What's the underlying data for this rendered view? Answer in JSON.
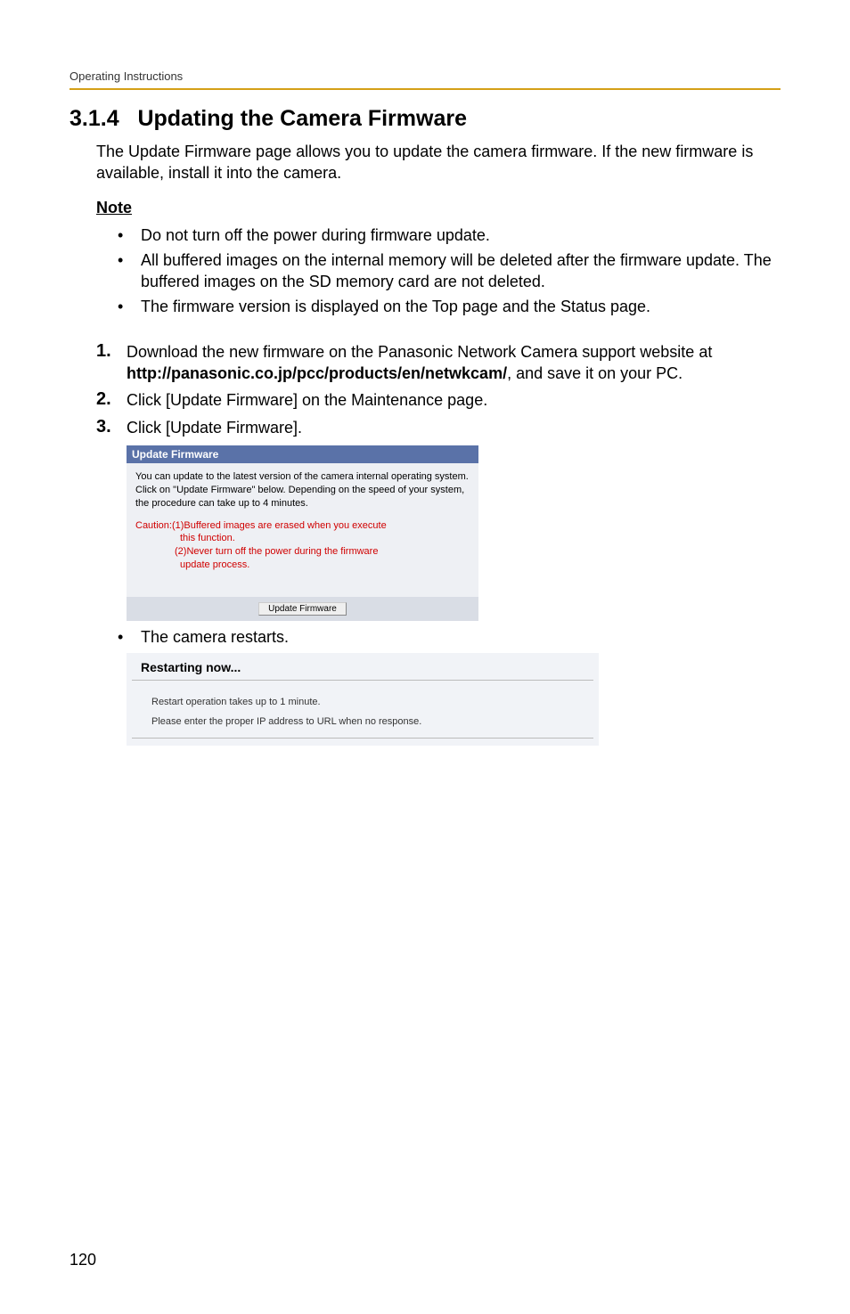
{
  "header": "Operating Instructions",
  "section_number": "3.1.4",
  "section_title": "Updating the Camera Firmware",
  "intro": "The Update Firmware page allows you to update the camera firmware. If the new firmware is available, install it into the camera.",
  "note_heading": "Note",
  "notes": [
    "Do not turn off the power during firmware update.",
    "All buffered images on the internal memory will be deleted after the firmware update. The buffered images on the SD memory card are not deleted.",
    "The firmware version is displayed on the Top page and the Status page."
  ],
  "steps": [
    {
      "num": "1.",
      "text_before": "Download the new firmware on the Panasonic Network Camera support website at ",
      "bold": "http://panasonic.co.jp/pcc/products/en/netwkcam/",
      "text_after": ", and save it on your PC."
    },
    {
      "num": "2.",
      "text_before": "Click [Update Firmware] on the Maintenance page.",
      "bold": "",
      "text_after": ""
    },
    {
      "num": "3.",
      "text_before": "Click [Update Firmware].",
      "bold": "",
      "text_after": ""
    }
  ],
  "screenshot1": {
    "title": "Update Firmware",
    "body": "You can update to the latest version of the camera internal operating system.\nClick on \"Update Firmware\" below. Depending on the speed of your system, the procedure can take up to 4 minutes.",
    "caution_label": "Caution:",
    "caution1": "(1)Buffered images are erased when you execute",
    "caution1b": "this function.",
    "caution2": "(2)Never turn off the power during the firmware",
    "caution2b": "update process.",
    "button": "Update Firmware"
  },
  "after_bullet": "The camera restarts.",
  "screenshot2": {
    "title": "Restarting now...",
    "line1": "Restart operation takes up to 1 minute.",
    "line2": "Please enter the proper IP address to URL when no response."
  },
  "page_number": "120"
}
